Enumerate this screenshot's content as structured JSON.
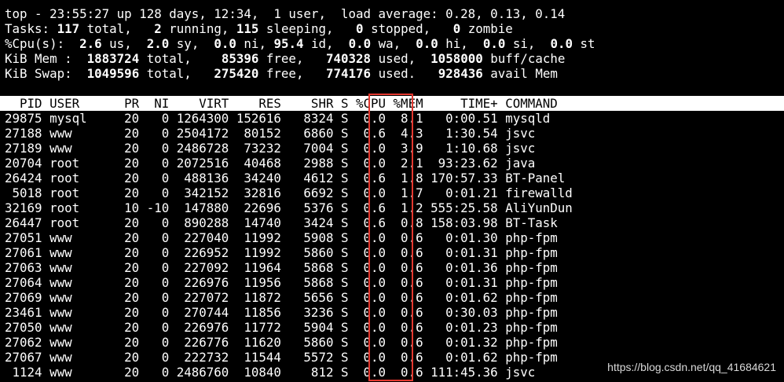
{
  "summary": {
    "line1": "top - 23:55:27 up 128 days, 12:34,  1 user,  load average: 0.28, 0.13, 0.14",
    "tasks": {
      "label": "Tasks: ",
      "total": "117",
      "t_total": " total,   ",
      "running": "2",
      "t_running": " running, ",
      "sleeping": "115",
      "t_sleeping": " sleeping,   ",
      "stopped": "0",
      "t_stopped": " stopped,   ",
      "zombie": "0",
      "t_zombie": " zombie"
    },
    "cpu": {
      "label": "%Cpu(s):  ",
      "us": "2.6",
      "t_us": " us,  ",
      "sy": "2.0",
      "t_sy": " sy,  ",
      "ni": "0.0",
      "t_ni": " ni, ",
      "id": "95.4",
      "t_id": " id,  ",
      "wa": "0.0",
      "t_wa": " wa,  ",
      "hi": "0.0",
      "t_hi": " hi,  ",
      "si": "0.0",
      "t_si": " si,  ",
      "st": "0.0",
      "t_st": " st"
    },
    "mem": {
      "label": "KiB Mem :  ",
      "total": "1883724",
      "t_total": " total,    ",
      "free": "85396",
      "t_free": " free,   ",
      "used": "740328",
      "t_used": " used,  ",
      "cache": "1058000",
      "t_cache": " buff/cache"
    },
    "swap": {
      "label": "KiB Swap:  ",
      "total": "1049596",
      "t_total": " total,   ",
      "free": "275420",
      "t_free": " free,   ",
      "used": "774176",
      "t_used": " used.   ",
      "avail": "928436",
      "t_avail": " avail Mem"
    }
  },
  "table_header": "  PID USER      PR  NI    VIRT    RES    SHR S %CPU %MEM     TIME+ COMMAND",
  "rows": [
    "29875 mysql     20   0 1264300 152616   8324 S  0.0  8.1   0:00.51 mysqld",
    "27188 www       20   0 2504172  80152   6860 S  0.6  4.3   1:30.54 jsvc",
    "27189 www       20   0 2486728  73232   7004 S  0.0  3.9   1:10.68 jsvc",
    "20704 root      20   0 2072516  40468   2988 S  0.0  2.1  93:23.62 java",
    "26424 root      20   0  488136  34240   4612 S  0.6  1.8 170:57.33 BT-Panel",
    " 5018 root      20   0  342152  32816   6692 S  0.0  1.7   0:01.21 firewalld",
    "32169 root      10 -10  147880  22696   5376 S  0.6  1.2 555:25.58 AliYunDun",
    "26447 root      20   0  890288  14740   3424 S  0.6  0.8 158:03.98 BT-Task",
    "27051 www       20   0  227040  11992   5908 S  0.0  0.6   0:01.30 php-fpm",
    "27061 www       20   0  226952  11992   5860 S  0.0  0.6   0:01.31 php-fpm",
    "27063 www       20   0  227092  11964   5868 S  0.0  0.6   0:01.36 php-fpm",
    "27064 www       20   0  226976  11956   5868 S  0.0  0.6   0:01.31 php-fpm",
    "27069 www       20   0  227072  11872   5656 S  0.0  0.6   0:01.62 php-fpm",
    "23461 www       20   0  270744  11856   3236 S  0.0  0.6   0:30.03 php-fpm",
    "27050 www       20   0  226976  11772   5904 S  0.0  0.6   0:01.23 php-fpm",
    "27062 www       20   0  226776  11620   5860 S  0.0  0.6   0:01.32 php-fpm",
    "27067 www       20   0  222732  11544   5572 S  0.0  0.6   0:01.62 php-fpm",
    " 1124 www       20   0 2486760  10840    812 S  0.0  0.6 111:45.36 jsvc"
  ],
  "watermark": "https://blog.csdn.net/qq_41684621",
  "colors": {
    "highlight_box": "#e3382f",
    "background": "#000000",
    "header_bg": "#ffffff"
  }
}
